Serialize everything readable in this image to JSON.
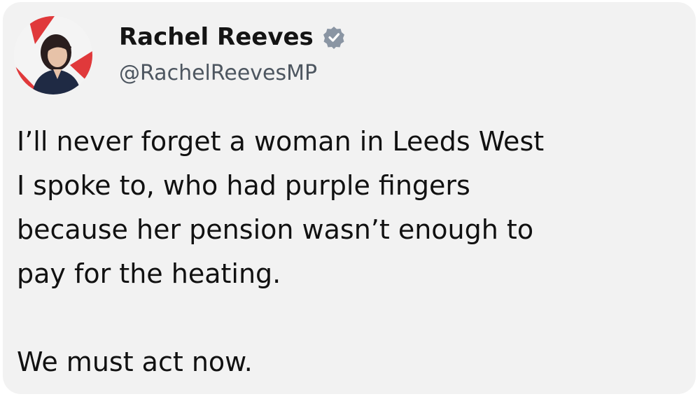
{
  "post": {
    "author": {
      "name": "Rachel Reeves",
      "handle": "@RachelReevesMP",
      "verified": true,
      "verified_badge_color": "#8a95a3",
      "avatar_icon": "profile-photo"
    },
    "text_lines": [
      "I’ll never forget a woman in Leeds West",
      "I spoke to, who had purple fingers",
      "because her pension wasn’t enough to",
      "pay for the heating."
    ],
    "closing_line": "We must act now."
  },
  "colors": {
    "card_background": "#f2f2f2",
    "text": "#111111",
    "handle": "#4d5660",
    "avatar_accent": "#e0393b"
  }
}
